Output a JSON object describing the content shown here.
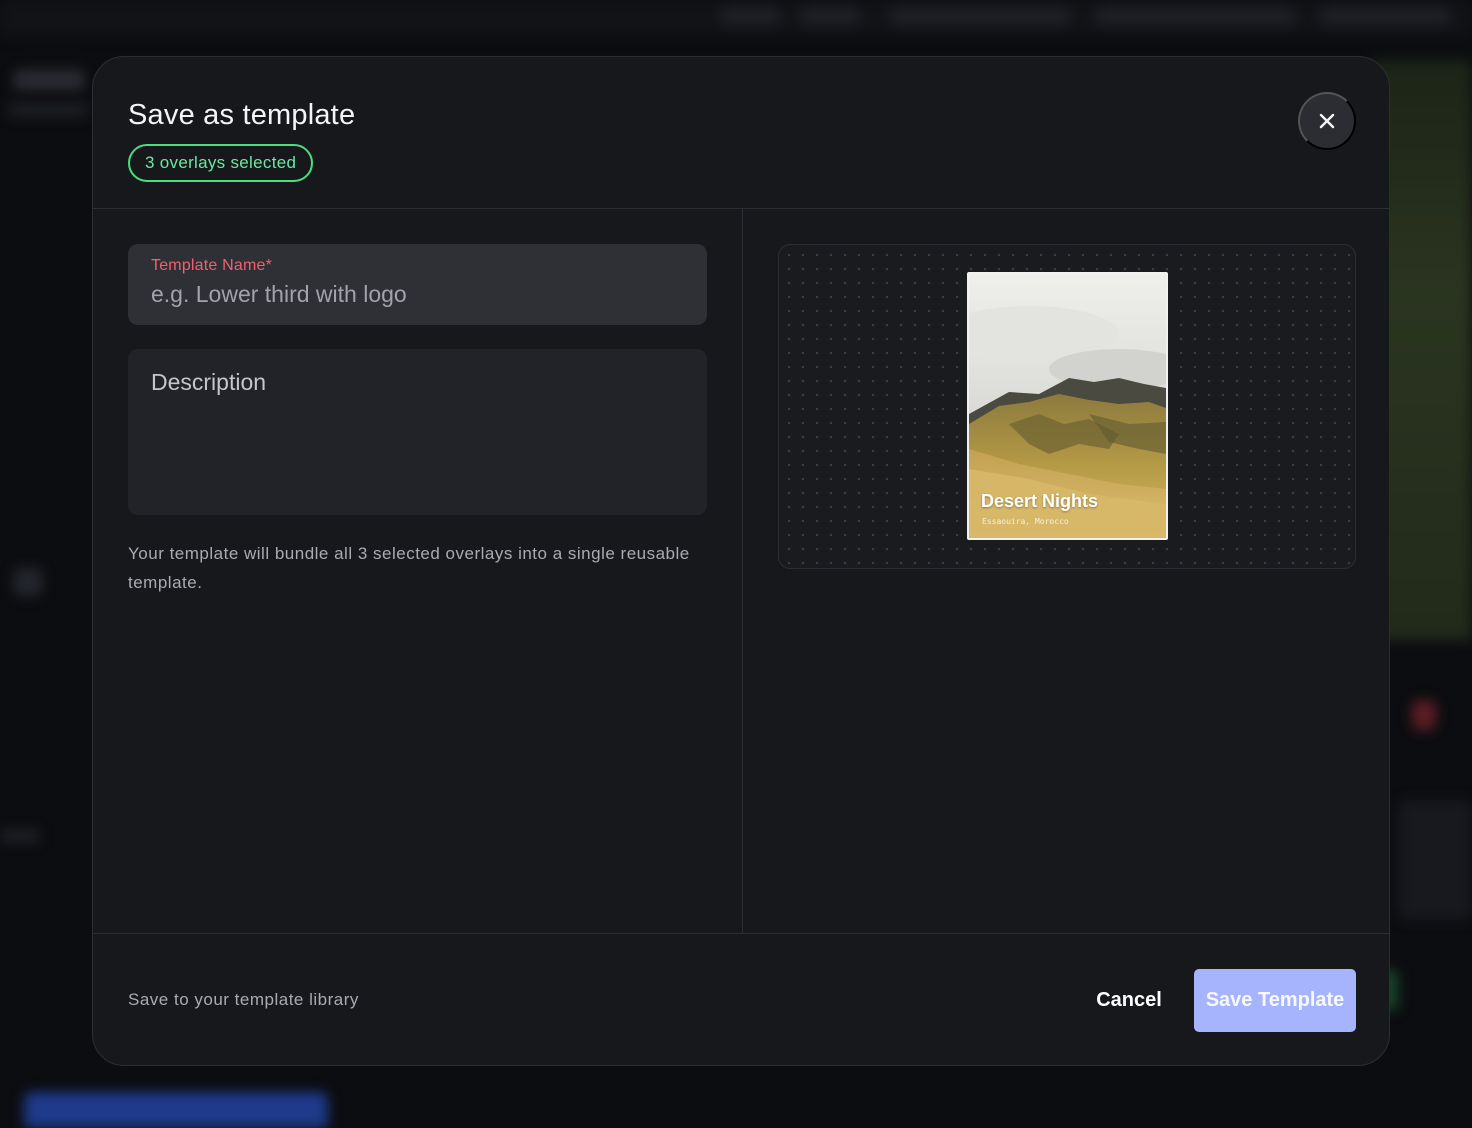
{
  "modal": {
    "title": "Save as template",
    "badge": "3 overlays selected",
    "close_icon": "close-icon"
  },
  "form": {
    "name_label": "Template Name*",
    "name_placeholder": "e.g. Lower third with logo",
    "name_value": "",
    "description_placeholder": "Description",
    "description_value": "",
    "helper_text": "Your template will bundle all 3 selected overlays into a single reusable template."
  },
  "preview": {
    "title": "Desert Nights",
    "subtitle": "Essaouira, Morocco"
  },
  "footer": {
    "note": "Save to your template library",
    "cancel_label": "Cancel",
    "save_label": "Save Template"
  },
  "colors": {
    "badge_accent": "#4ade80",
    "required_label": "#f0606e",
    "save_button": "#a5b4fc"
  }
}
